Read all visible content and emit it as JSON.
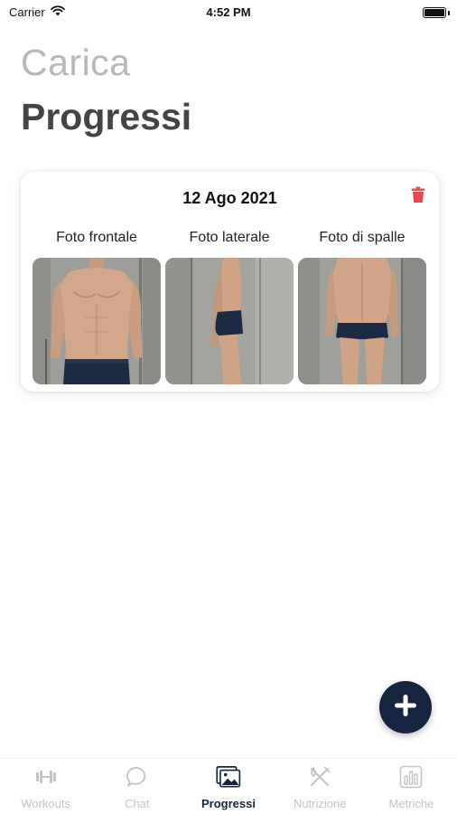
{
  "status_bar": {
    "carrier": "Carrier",
    "time": "4:52 PM"
  },
  "header": {
    "title_light": "Carica",
    "title_bold": "Progressi"
  },
  "entry": {
    "date": "12 Ago 2021",
    "photos": [
      {
        "label": "Foto frontale",
        "view": "front"
      },
      {
        "label": "Foto laterale",
        "view": "side"
      },
      {
        "label": "Foto di spalle",
        "view": "back"
      }
    ]
  },
  "fab": {
    "icon": "plus-icon"
  },
  "tab_bar": {
    "tabs": [
      {
        "label": "Workouts",
        "icon": "dumbbell-icon",
        "active": false
      },
      {
        "label": "Chat",
        "icon": "chat-bubble-icon",
        "active": false
      },
      {
        "label": "Progressi",
        "icon": "photo-gallery-icon",
        "active": true
      },
      {
        "label": "Nutrizione",
        "icon": "fork-knife-icon",
        "active": false
      },
      {
        "label": "Metriche",
        "icon": "bar-chart-icon",
        "active": false
      }
    ]
  },
  "colors": {
    "accent": "#15243f",
    "delete": "#e5484d",
    "inactive": "#c4c4c4",
    "title_light": "#b8b8b8",
    "title_bold": "#444444"
  }
}
